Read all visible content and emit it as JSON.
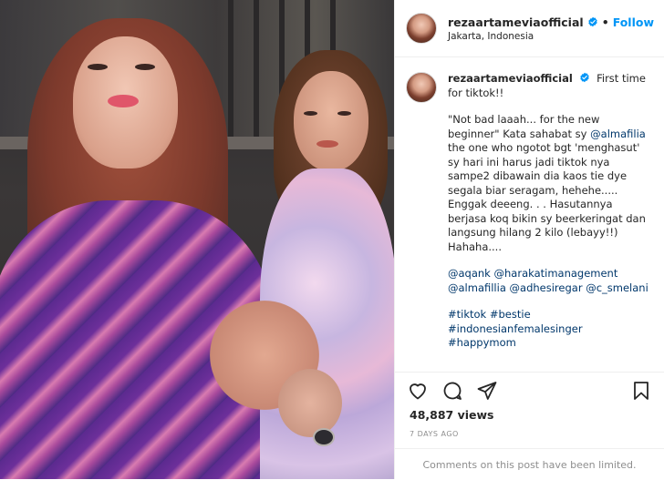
{
  "post": {
    "username": "rezaartameviaofficial",
    "follow_label": "Follow",
    "separator": "•",
    "location": "Jakarta, Indonesia",
    "caption": {
      "lead": "First time for tiktok!!",
      "p1": {
        "pre": "\"Not bad laaah... for the new beginner\" Kata sahabat sy ",
        "mention": "@almafilia",
        "post": " the one who ngotot bgt 'menghasut' sy hari ini harus jadi tiktok nya sampe2 dibawain dia kaos tie dye segala biar seragam, hehehe..... Enggak deeeng. . . Hasutannya berjasa koq bikin sy beerkeringat dan langsung hilang 2 kilo (lebayy!!) Hahaha...."
      },
      "mentions": [
        "@aqank",
        "@harakatimanagement",
        "@almafillia",
        "@adhesiregar",
        "@c_smelani"
      ],
      "hashtags": [
        "#tiktok",
        "#bestie",
        "#indonesianfemalesinger",
        "#happymom"
      ]
    },
    "views": "48,887 views",
    "date": "7 DAYS AGO",
    "comments_limited": "Comments on this post have been limited."
  },
  "icons": {
    "verified": "verified-badge-icon",
    "like": "heart-icon",
    "comment": "comment-bubble-icon",
    "share": "paper-plane-icon",
    "save": "bookmark-icon",
    "verified_color": "#0095f6",
    "follow_color": "#0095f6",
    "link_color": "#00376b"
  }
}
